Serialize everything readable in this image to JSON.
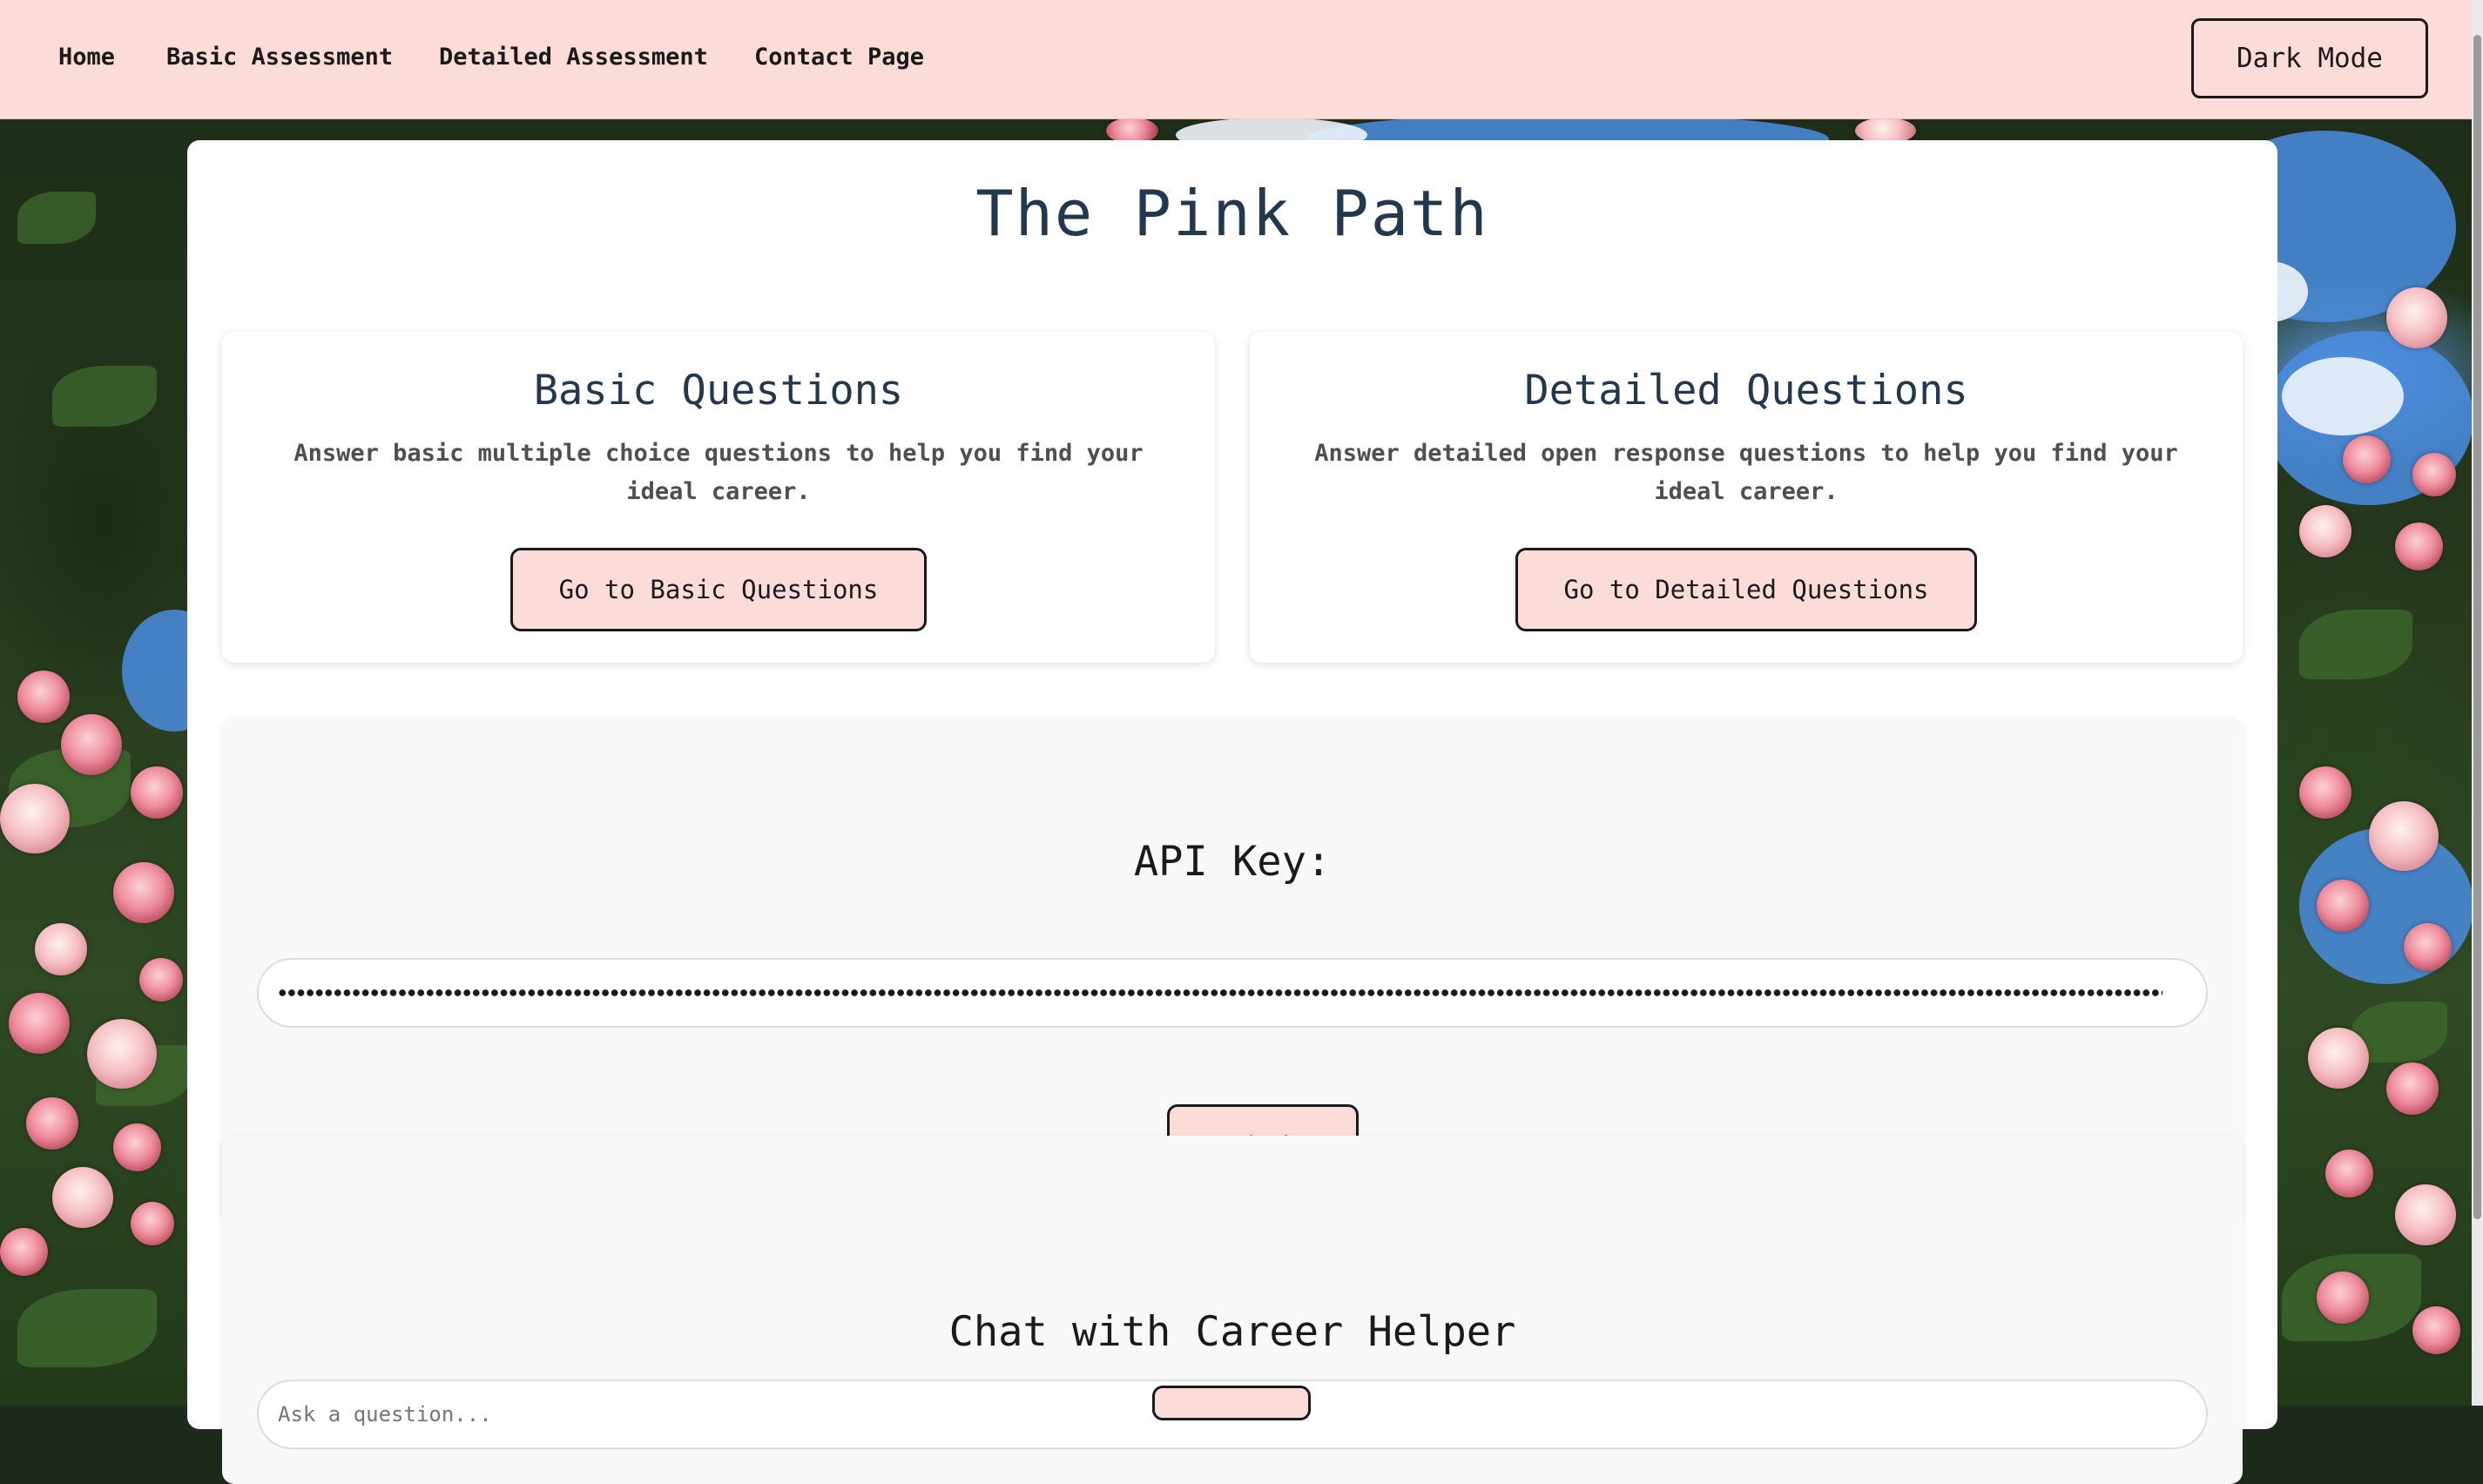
{
  "nav": {
    "links": [
      {
        "label": "Home"
      },
      {
        "label": "Basic Assessment"
      },
      {
        "label": "Detailed Assessment"
      },
      {
        "label": "Contact Page"
      }
    ],
    "dark_mode_label": "Dark Mode"
  },
  "page": {
    "title": "The Pink Path"
  },
  "cards": [
    {
      "title": "Basic Questions",
      "description": "Answer basic multiple choice questions to help you find your ideal career.",
      "button_label": "Go to Basic Questions"
    },
    {
      "title": "Detailed Questions",
      "description": "Answer detailed open response questions to help you find your ideal career.",
      "button_label": "Go to Detailed Questions"
    }
  ],
  "api": {
    "label": "API Key:",
    "submit_label": "Submit"
  },
  "chat": {
    "title": "Chat with Career Helper",
    "placeholder": "Ask a question..."
  },
  "colors": {
    "nav_bg": "#fcdcd9",
    "button_bg": "#fcdcd9",
    "title_color": "#22384f",
    "panel_bg": "#f8f8f8"
  },
  "icons": {
    "background": "rose-garden-image"
  }
}
